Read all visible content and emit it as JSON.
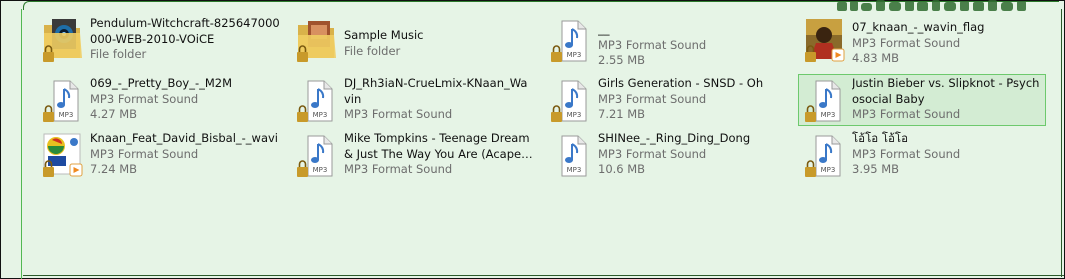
{
  "colors": {
    "background": "#e6f4e6",
    "selection_fill": "#d3ecd3",
    "selection_border": "#6dc96d",
    "secondary_text": "#6d6d6d",
    "mp3_note": "#3a78c8"
  },
  "items": [
    {
      "name": "Pendulum-Witchcraft-825647000000-WEB-2010-VOiCE",
      "line2": "File folder",
      "line3": "",
      "icon": "folder-webcam-thumbnail-icon"
    },
    {
      "name": "Sample Music",
      "line2": "File folder",
      "line3": "",
      "icon": "folder-album-art-icon"
    },
    {
      "name": "__",
      "line2": "MP3 Format Sound",
      "line3": "2.55 MB",
      "icon": "mp3-file-icon"
    },
    {
      "name": "07_knaan_-_wavin_flag",
      "line2": "MP3 Format Sound",
      "line3": "4.83 MB",
      "icon": "album-art-knaan-icon"
    },
    {
      "name": "069_-_Pretty_Boy_-_M2M",
      "line2": "MP3 Format Sound",
      "line3": "4.27 MB",
      "icon": "mp3-file-icon"
    },
    {
      "name": "DJ_Rh3iaN-CrueLmix-KNaan_Wavin",
      "line2": "MP3 Format Sound",
      "line3": "",
      "icon": "mp3-file-icon"
    },
    {
      "name": "Girls Generation - SNSD - Oh",
      "line2": "MP3 Format Sound",
      "line3": "7.21 MB",
      "icon": "mp3-file-icon"
    },
    {
      "name": "Justin Bieber vs. Slipknot - Psychosocial Baby",
      "line2": "MP3 Format Sound",
      "line3": "",
      "icon": "mp3-file-icon",
      "selected": true
    },
    {
      "name": "Knaan_Feat_David_Bisbal_-_wavi",
      "line2": "MP3 Format Sound",
      "line3": "7.24 MB",
      "icon": "album-art-worldcup-icon"
    },
    {
      "name": "Mike Tompkins - Teenage Dream & Just The Way You Are (Acapell...",
      "line2": "MP3 Format Sound",
      "line3": "",
      "icon": "mp3-file-icon"
    },
    {
      "name": "SHINee_-_Ring_Ding_Dong",
      "line2": "MP3 Format Sound",
      "line3": "10.6 MB",
      "icon": "mp3-file-icon"
    },
    {
      "name": "โอ้โอ โอ้โอ",
      "line2": "MP3 Format Sound",
      "line3": "3.95 MB",
      "icon": "mp3-file-icon"
    }
  ]
}
